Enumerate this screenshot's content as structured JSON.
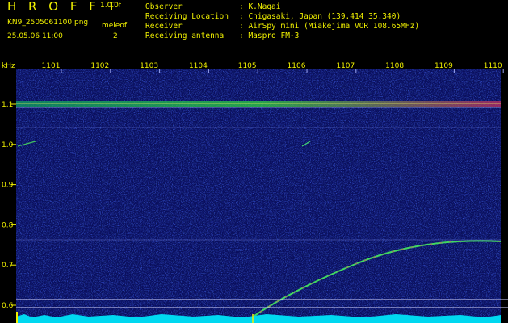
{
  "header": {
    "app_title": "H R O F F T",
    "app_version": "1.0.0f",
    "filename": "KN9_2505061100.png",
    "datetime": "25.05.06 11:00",
    "meleo_label": "meleof",
    "meleo_value": "2",
    "meta": [
      {
        "key": "Observer",
        "value": ": K.Nagai"
      },
      {
        "key": "Receiving Location",
        "value": ": Chigasaki, Japan (139.414 35.340)"
      },
      {
        "key": "Receiver",
        "value": ": AirSpy mini (Miakejima VOR 108.65MHz)"
      },
      {
        "key": "Receiving antenna",
        "value": ": Maspro FM-3"
      }
    ]
  },
  "spectrogram": {
    "y_unit": "kHz",
    "time_ticks": [
      "1101",
      "1102",
      "1103",
      "1104",
      "1105",
      "1106",
      "1107",
      "1108",
      "1109",
      "1110"
    ],
    "freq_ticks": [
      "1.1",
      "1.0",
      "0.9",
      "0.8",
      "0.7",
      "0.6"
    ],
    "colors": {
      "background": "#0a0f5e",
      "label": "#f0f000",
      "baseline": "#00d8f0",
      "signal": "#30e040"
    }
  }
}
